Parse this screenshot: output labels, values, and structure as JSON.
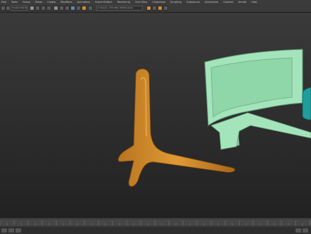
{
  "menu": {
    "items": [
      "Edit",
      "Tools",
      "Group",
      "Views",
      "Create",
      "Modifiers",
      "Animation",
      "Graph Editors",
      "Rendering",
      "Civil View",
      "Customize",
      "Scripting",
      "Substance",
      "Interactive",
      "Content",
      "Arnold",
      "Help"
    ]
  },
  "toolbar": {
    "selection_set": "Create Selection Se",
    "path": "C:/Users/.../3ds Max 2020/scenes"
  },
  "viewport": {
    "background": "#2c2c2c",
    "objects": [
      {
        "name": "hat-stand",
        "color": "#d08a2a"
      },
      {
        "name": "curved-monitor",
        "color": "#a6e6bd"
      },
      {
        "name": "cylinder-object",
        "color": "#1fa0a0"
      }
    ]
  }
}
